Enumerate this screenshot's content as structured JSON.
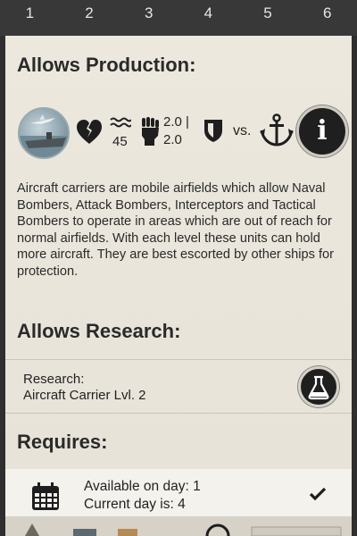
{
  "tabs": [
    "1",
    "2",
    "3",
    "4",
    "5",
    "6"
  ],
  "production": {
    "heading": "Allows Production:",
    "unit_icon": "aircraft-carrier-portrait",
    "stat_health_icon": "broken-heart-icon",
    "stat_speed_icon": "waves-icon",
    "stat_speed_value": "45",
    "stat_attack_icon": "fist-icon",
    "stat_attack_value_line1": "2.0 |",
    "stat_attack_value_line2": "2.0",
    "stat_defense_icon": "shield-icon",
    "vs_label": "vs.",
    "vs_target_icon": "anchor-icon",
    "info_button_icon": "info-icon",
    "info_label": "i",
    "description": "Aircraft carriers are mobile airfields which allow Naval Bombers, Attack Bombers, Interceptors and Tactical Bombers to operate in areas which are out of reach for normal airfields. With each level these units can hold more aircraft. They are best escorted by other ships for protection."
  },
  "research": {
    "heading": "Allows Research:",
    "label_line1": "Research:",
    "label_line2": "Aircraft Carrier Lvl. 2",
    "button_icon": "flask-icon"
  },
  "requires": {
    "heading": "Requires:",
    "icon": "calendar-icon",
    "available_line": "Available on day: 1",
    "current_line": "Current day is: 4",
    "status_icon": "checkmark-icon"
  },
  "colors": {
    "panel": "#e9e5db",
    "tabbar": "#383838",
    "dark_button": "#1f1f1f"
  }
}
